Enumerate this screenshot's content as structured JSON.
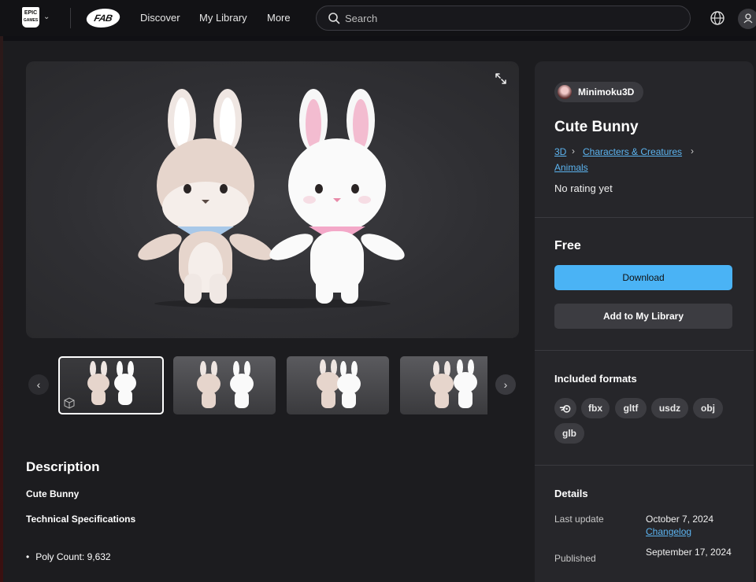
{
  "nav": {
    "epic_logo_text": "EPIC GAMES",
    "fab_logo_text": "FAB",
    "links": [
      "Discover",
      "My Library",
      "More"
    ],
    "search_placeholder": "Search"
  },
  "product": {
    "creator": "Minimoku3D",
    "title": "Cute Bunny",
    "breadcrumb": [
      "3D",
      "Characters & Creatures",
      "Animals"
    ],
    "rating": "No rating yet",
    "price": "Free",
    "download_label": "Download",
    "add_library_label": "Add to My Library"
  },
  "formats": {
    "heading": "Included formats",
    "items": [
      "fbx",
      "gltf",
      "usdz",
      "obj",
      "glb"
    ],
    "blender_icon": "blender-icon"
  },
  "details": {
    "heading": "Details",
    "last_update_label": "Last update",
    "last_update_value": "October 7, 2024",
    "changelog_label": "Changelog",
    "published_label": "Published",
    "published_value": "September 17, 2024"
  },
  "description": {
    "heading": "Description",
    "subtitle": "Cute Bunny",
    "tech_heading": "Technical Specifications",
    "bullets": [
      "Poly Count: 9,632"
    ]
  },
  "colors": {
    "accent": "#4ab3f5",
    "link": "#5cb4f0",
    "panel": "#26262a"
  }
}
